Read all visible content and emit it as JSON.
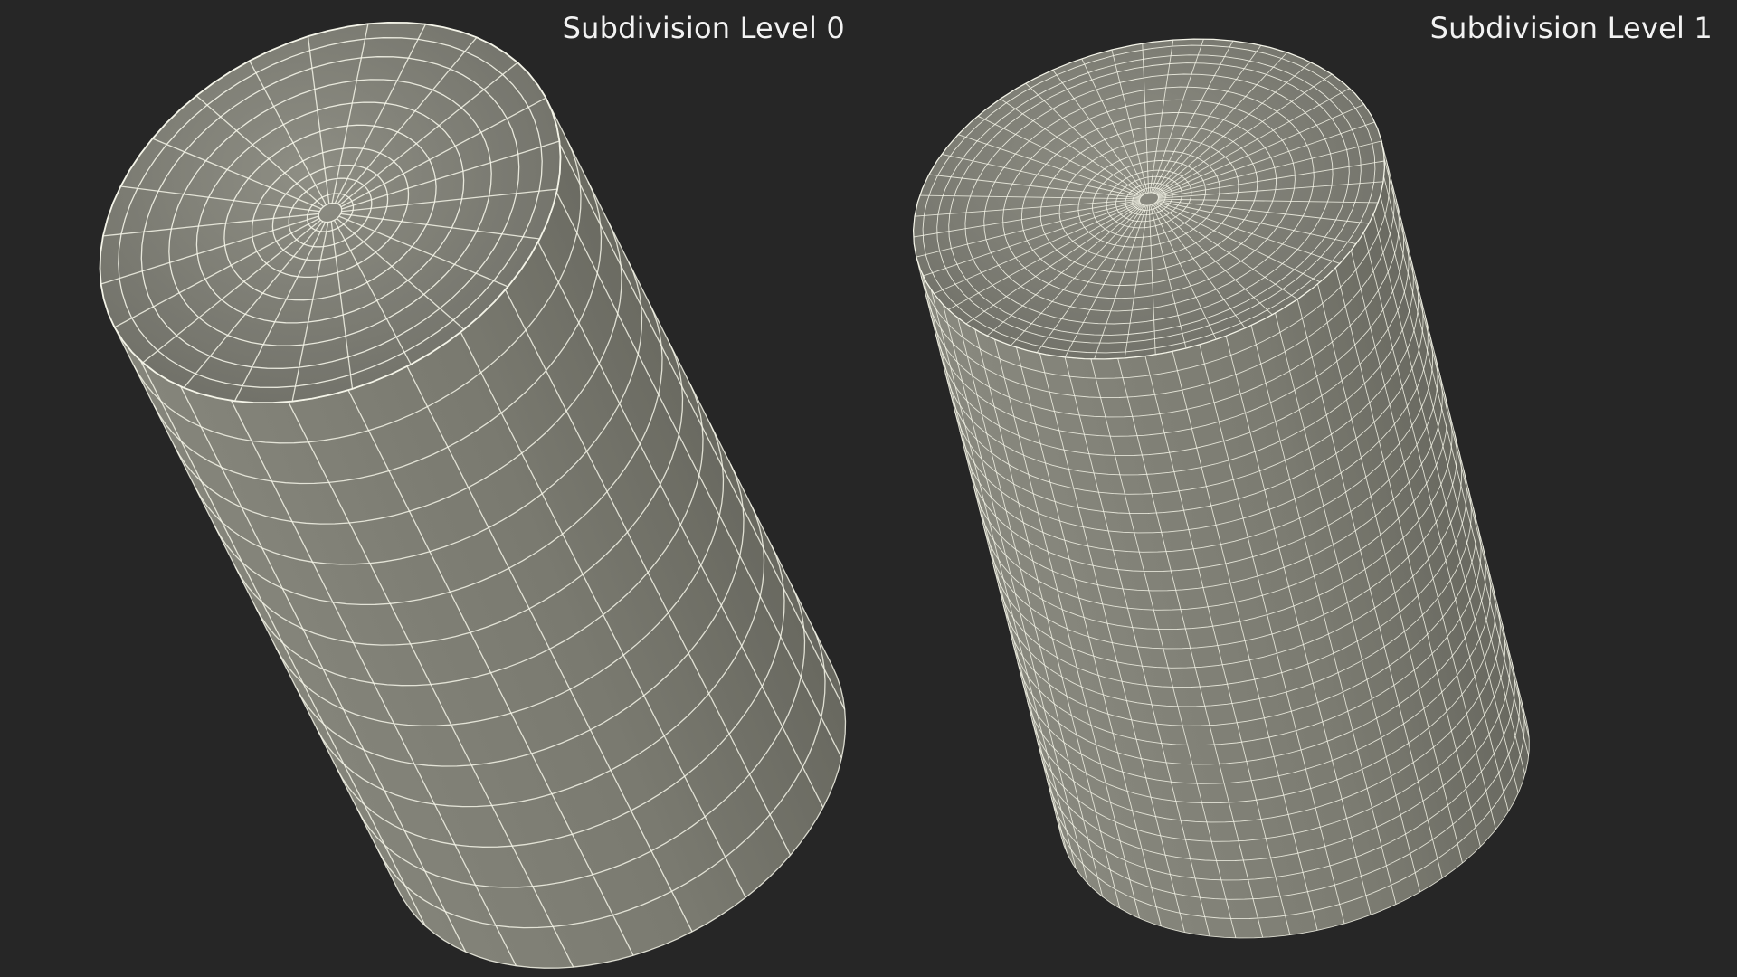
{
  "render": {
    "background": "#262626",
    "mesh_fill": "#7a7a70",
    "wire_color": "#f4f4e8"
  },
  "views": [
    {
      "label": "Subdivision Level 0"
    },
    {
      "label": "Subdivision Level 1"
    }
  ]
}
